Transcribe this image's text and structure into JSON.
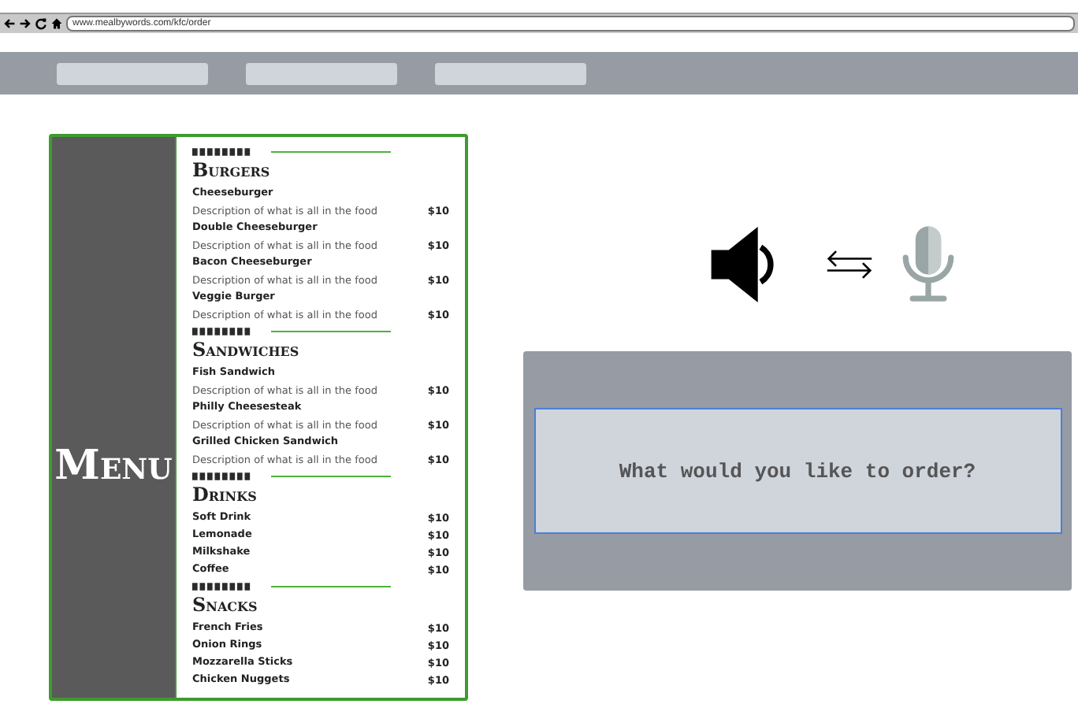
{
  "browser": {
    "url": "www.mealbywords.com/kfc/order"
  },
  "nav": {
    "items": [
      {
        "kind": "placeholder"
      },
      {
        "kind": "placeholder"
      },
      {
        "kind": "placeholder"
      }
    ]
  },
  "menu": {
    "title": "Menu",
    "sections": [
      {
        "heading": "Burgers",
        "items": [
          {
            "name": "Cheeseburger",
            "description": "Description of what is all in the food",
            "price": "$10"
          },
          {
            "name": "Double Cheeseburger",
            "description": "Description of what is all in the food",
            "price": "$10"
          },
          {
            "name": "Bacon Cheeseburger",
            "description": "Description of what is all in the food",
            "price": "$10"
          },
          {
            "name": "Veggie Burger",
            "description": "Description of what is all in the food",
            "price": "$10"
          }
        ]
      },
      {
        "heading": "Sandwiches",
        "items": [
          {
            "name": "Fish Sandwich",
            "description": "Description of what is all in the food",
            "price": "$10"
          },
          {
            "name": "Philly Cheesesteak",
            "description": "Description of what is all in the food",
            "price": "$10"
          },
          {
            "name": "Grilled Chicken Sandwich",
            "description": "Description of what is all in the food",
            "price": "$10"
          }
        ]
      },
      {
        "heading": "Drinks",
        "items": [
          {
            "name": "Soft Drink",
            "price": "$10"
          },
          {
            "name": "Lemonade",
            "price": "$10"
          },
          {
            "name": "Milkshake",
            "price": "$10"
          },
          {
            "name": "Coffee",
            "price": "$10"
          }
        ]
      },
      {
        "heading": "Snacks",
        "items": [
          {
            "name": "French Fries",
            "price": "$10"
          },
          {
            "name": "Onion Rings",
            "price": "$10"
          },
          {
            "name": "Mozzarella Sticks",
            "price": "$10"
          },
          {
            "name": "Chicken Nuggets",
            "price": "$10"
          }
        ]
      }
    ]
  },
  "voice": {
    "prompt": "What would you like to order?"
  }
}
